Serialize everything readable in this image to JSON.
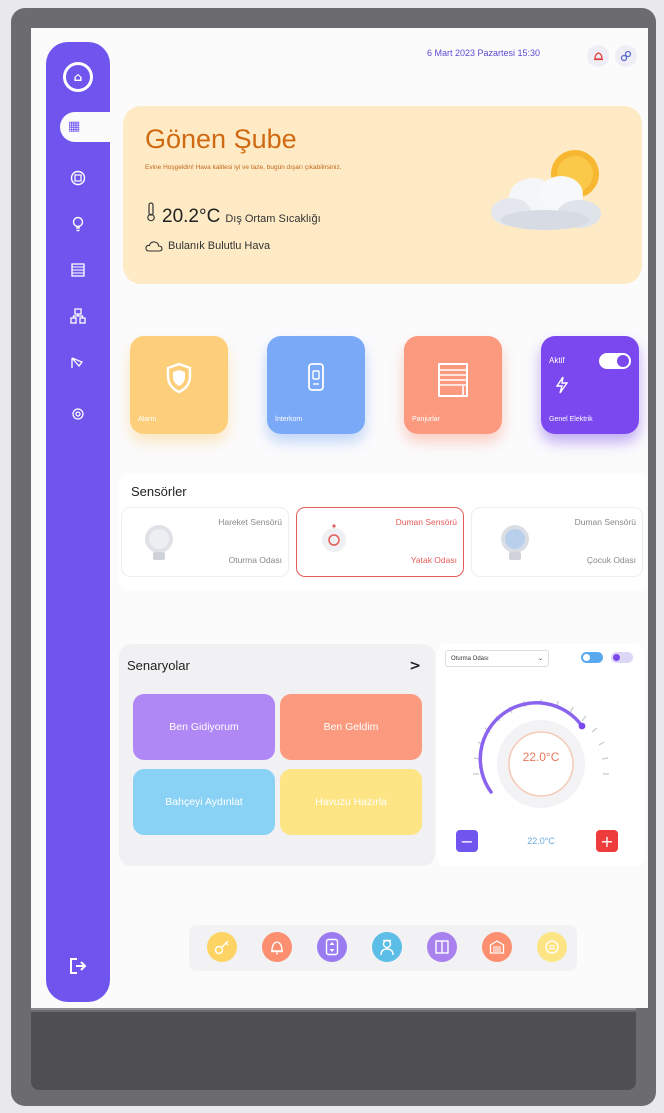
{
  "header": {
    "datetime": "6 Mart 2023 Pazartesi 15:30",
    "alarm_icon": "bell-icon",
    "link_icon": "link-icon",
    "accent": "#6f55ee"
  },
  "sidebar": {
    "items": [
      {
        "name": "dashboard",
        "icon": "dashboard-icon"
      },
      {
        "name": "building",
        "icon": "building-icon"
      },
      {
        "name": "lighting",
        "icon": "lightbulb-icon"
      },
      {
        "name": "blinds",
        "icon": "blinds-icon"
      },
      {
        "name": "network",
        "icon": "network-icon"
      },
      {
        "name": "camera",
        "icon": "camera-icon"
      },
      {
        "name": "settings",
        "icon": "settings-icon"
      }
    ],
    "exit_icon": "exit-icon"
  },
  "weather": {
    "title": "Gönen Şube",
    "welcome": "Evine Hoşgeldin! Hava kalitesi iyi ve taze, bugün dışarı çıkabilirsiniz.",
    "temperature": "20.2°C",
    "temperature_label": "Dış Ortam Sıcaklığı",
    "condition": "Bulanık Bulutlu Hava"
  },
  "tiles": [
    {
      "label": "Alarm",
      "color": "#fdcf7b",
      "icon": "shield-icon"
    },
    {
      "label": "İnterkom",
      "color": "#7aa9f7",
      "icon": "intercom-icon"
    },
    {
      "label": "Panjurlar",
      "color": "#fb9a7f",
      "icon": "blinds-icon"
    },
    {
      "label": "Genel Elektrik",
      "color": "#7a48ee",
      "icon": "lightning-icon",
      "status": "Aktif",
      "toggle_on": true
    }
  ],
  "sensors": {
    "title": "Sensörler",
    "items": [
      {
        "name": "Hareket Sensörü",
        "room": "Oturma Odası",
        "active": false
      },
      {
        "name": "Duman Sensörü",
        "room": "Yatak Odası",
        "active": true
      },
      {
        "name": "Duman Sensörü",
        "room": "Çocuk Odası",
        "active": false
      }
    ]
  },
  "scenarios": {
    "title": "Senaryolar",
    "arrow": ">",
    "buttons": [
      {
        "label": "Ben Gidiyorum",
        "color": "#b088f5"
      },
      {
        "label": "Ben Geldim",
        "color": "#fb9a7f"
      },
      {
        "label": "Bahçeyi Aydınlat",
        "color": "#8ad2f5"
      },
      {
        "label": "Havuzu Hazırla",
        "color": "#fde585"
      }
    ]
  },
  "thermostat": {
    "room": "Oturma Odası",
    "current": "22.0°C",
    "setpoint": "22.0°C",
    "minus": "−",
    "plus": "+"
  },
  "dock": [
    {
      "icon": "key-icon",
      "color": "#fdd364"
    },
    {
      "icon": "bell-icon",
      "color": "#fb8f6f"
    },
    {
      "icon": "elevator-icon",
      "color": "#9a7cf0"
    },
    {
      "icon": "doorman-icon",
      "color": "#5cbde6"
    },
    {
      "icon": "door-icon",
      "color": "#a881ee"
    },
    {
      "icon": "garage-icon",
      "color": "#fb8f6f"
    },
    {
      "icon": "note-icon",
      "color": "#fde585"
    }
  ]
}
